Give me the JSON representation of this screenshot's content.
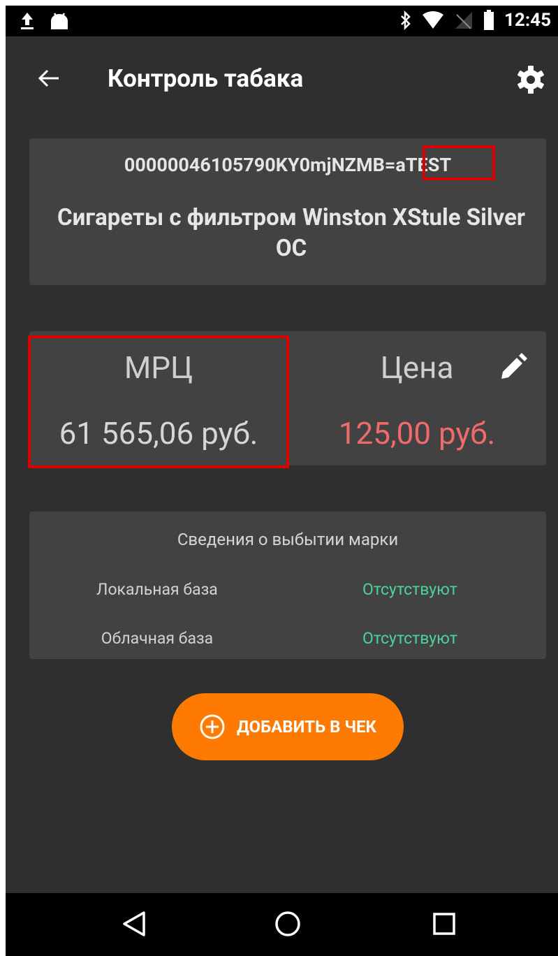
{
  "status_bar": {
    "time": "12:45"
  },
  "app_bar": {
    "title": "Контроль табака"
  },
  "code_card": {
    "code_prefix": "00000046105790KY0mjNZMB=a",
    "code_highlight": "TEST",
    "product_name": "Сигареты с фильтром Winston XStule Silver  OC"
  },
  "price_card": {
    "mrp_label": "МРЦ",
    "mrp_value": "61 565,06 руб.",
    "price_label": "Цена",
    "price_value": "125,00 руб."
  },
  "info_card": {
    "title": "Сведения о выбытии марки",
    "rows": [
      {
        "label": "Локальная база",
        "value": "Отсутствуют"
      },
      {
        "label": "Облачная база",
        "value": "Отсутствуют"
      }
    ]
  },
  "add_button": {
    "label": "ДОБАВИТЬ В ЧЕК",
    "icon": "plus-circle-icon"
  },
  "colors": {
    "accent": "#ff7a00",
    "price": "#ef6b6b",
    "status_ok": "#4ad39a",
    "highlight": "#e00000"
  }
}
